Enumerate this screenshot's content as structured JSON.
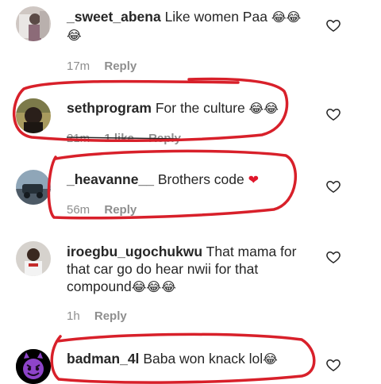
{
  "comments": [
    {
      "username": "_sweet_abena",
      "text": "Like women Paa",
      "emojis": "😂😂😂",
      "time": "17m",
      "likes": "",
      "reply": "Reply",
      "avatar_icon": "user-avatar"
    },
    {
      "username": "sethprogram",
      "text": "For the culture",
      "emojis": "😂😂",
      "time": "21m",
      "likes": "1 like",
      "reply": "Reply",
      "avatar_icon": "user-avatar"
    },
    {
      "username": "_heavanne__",
      "text": "Brothers code",
      "emojis": "❤",
      "time": "56m",
      "likes": "",
      "reply": "Reply",
      "avatar_icon": "user-avatar"
    },
    {
      "username": "iroegbu_ugochukwu",
      "text": "That mama for that car go do hear nwii for that compound",
      "emojis": "😂😂😂",
      "time": "1h",
      "likes": "",
      "reply": "Reply",
      "avatar_icon": "user-avatar"
    },
    {
      "username": "badman_4l",
      "text": "Baba won knack lol",
      "emojis": "😂",
      "time": "",
      "likes": "",
      "reply": "",
      "avatar_icon": "devil-emoji-avatar"
    }
  ],
  "colors": {
    "text": "#262626",
    "meta": "#8e8e8e",
    "markup_red": "#d8202a",
    "heart_red": "#e0162b"
  }
}
